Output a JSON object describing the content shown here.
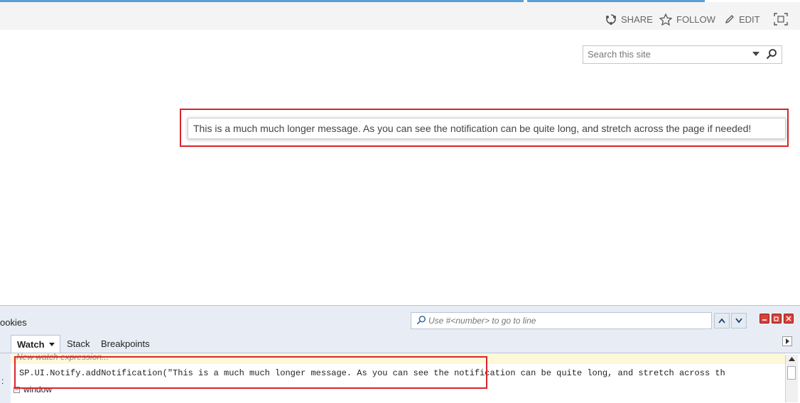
{
  "suite_actions": {
    "share": "SHARE",
    "follow": "FOLLOW",
    "edit": "EDIT"
  },
  "search": {
    "placeholder": "Search this site"
  },
  "notification": {
    "message": "This is a much much longer message. As you can see the notification can be quite long, and stretch across the page if needed!"
  },
  "devtools": {
    "tab_label_partial": "ookies",
    "goto_line_hint": "Use #<number> to go to line",
    "tabs": {
      "watch": "Watch",
      "stack": "Stack",
      "breakpoints": "Breakpoints"
    },
    "watch": {
      "new_watch": "New watch expression...",
      "expression": "SP.UI.Notify.addNotification(\"This is a much much longer message. As you can see the notification can be quite long, and stretch across th",
      "window_row": "window",
      "left_marker": ":"
    }
  },
  "colors": {
    "highlight_box": "#d9252a",
    "accent_blue": "#5b9fd4"
  }
}
